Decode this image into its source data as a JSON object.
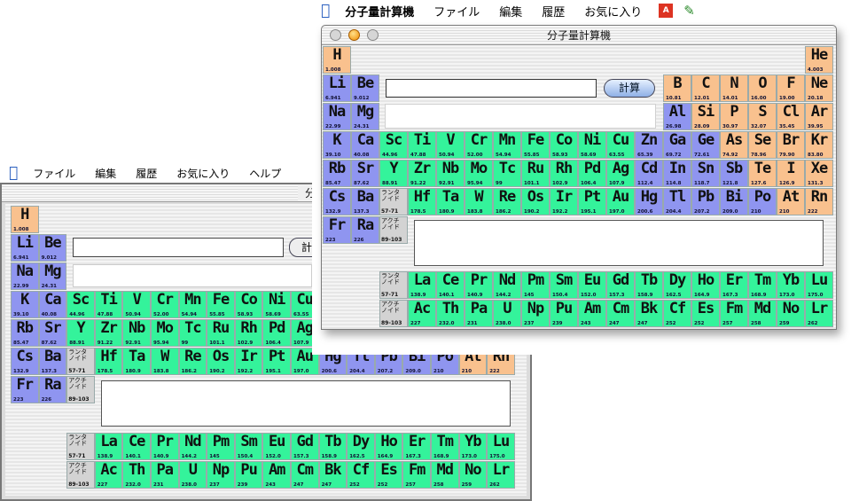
{
  "menubar_back": {
    "items": [
      "ファイル",
      "編集",
      "履歴",
      "お気に入り",
      "ヘルプ"
    ]
  },
  "menubar_front": {
    "items": [
      "分子量計算機",
      "ファイル",
      "編集",
      "履歴",
      "お気に入り"
    ]
  },
  "window_back": {
    "title": "分子量計算機"
  },
  "window_front": {
    "title": "分子量計算機",
    "calc_label": "計算",
    "calc_label_partial": "計"
  },
  "icons": {
    "apple": "apple-icon",
    "app_badge": "acrobat-icon",
    "pen": "pencil-icon"
  },
  "colors": {
    "s_block": "#8f95f0",
    "d_block": "#34f39b",
    "p_block": "#f9c18e",
    "series": "#d3d3d3"
  },
  "table": {
    "elements": [
      {
        "s": "H",
        "w": "1.008",
        "r": 0,
        "c": 0,
        "t": "p"
      },
      {
        "s": "He",
        "w": "4.003",
        "r": 0,
        "c": 17,
        "t": "p"
      },
      {
        "s": "Li",
        "w": "6.941",
        "r": 1,
        "c": 0,
        "t": "s"
      },
      {
        "s": "Be",
        "w": "9.012",
        "r": 1,
        "c": 1,
        "t": "s"
      },
      {
        "s": "B",
        "w": "10.81",
        "r": 1,
        "c": 12,
        "t": "p"
      },
      {
        "s": "C",
        "w": "12.01",
        "r": 1,
        "c": 13,
        "t": "p"
      },
      {
        "s": "N",
        "w": "14.01",
        "r": 1,
        "c": 14,
        "t": "p"
      },
      {
        "s": "O",
        "w": "16.00",
        "r": 1,
        "c": 15,
        "t": "p"
      },
      {
        "s": "F",
        "w": "19.00",
        "r": 1,
        "c": 16,
        "t": "p"
      },
      {
        "s": "Ne",
        "w": "20.18",
        "r": 1,
        "c": 17,
        "t": "p"
      },
      {
        "s": "Na",
        "w": "22.99",
        "r": 2,
        "c": 0,
        "t": "s"
      },
      {
        "s": "Mg",
        "w": "24.31",
        "r": 2,
        "c": 1,
        "t": "s"
      },
      {
        "s": "Al",
        "w": "26.98",
        "r": 2,
        "c": 12,
        "t": "s"
      },
      {
        "s": "Si",
        "w": "28.09",
        "r": 2,
        "c": 13,
        "t": "p"
      },
      {
        "s": "P",
        "w": "30.97",
        "r": 2,
        "c": 14,
        "t": "p"
      },
      {
        "s": "S",
        "w": "32.07",
        "r": 2,
        "c": 15,
        "t": "p"
      },
      {
        "s": "Cl",
        "w": "35.45",
        "r": 2,
        "c": 16,
        "t": "p"
      },
      {
        "s": "Ar",
        "w": "39.95",
        "r": 2,
        "c": 17,
        "t": "p"
      },
      {
        "s": "K",
        "w": "39.10",
        "r": 3,
        "c": 0,
        "t": "s"
      },
      {
        "s": "Ca",
        "w": "40.08",
        "r": 3,
        "c": 1,
        "t": "s"
      },
      {
        "s": "Sc",
        "w": "44.96",
        "r": 3,
        "c": 2,
        "t": "d"
      },
      {
        "s": "Ti",
        "w": "47.88",
        "r": 3,
        "c": 3,
        "t": "d"
      },
      {
        "s": "V",
        "w": "50.94",
        "r": 3,
        "c": 4,
        "t": "d"
      },
      {
        "s": "Cr",
        "w": "52.00",
        "r": 3,
        "c": 5,
        "t": "d"
      },
      {
        "s": "Mn",
        "w": "54.94",
        "r": 3,
        "c": 6,
        "t": "d"
      },
      {
        "s": "Fe",
        "w": "55.85",
        "r": 3,
        "c": 7,
        "t": "d"
      },
      {
        "s": "Co",
        "w": "58.93",
        "r": 3,
        "c": 8,
        "t": "d"
      },
      {
        "s": "Ni",
        "w": "58.69",
        "r": 3,
        "c": 9,
        "t": "d"
      },
      {
        "s": "Cu",
        "w": "63.55",
        "r": 3,
        "c": 10,
        "t": "d"
      },
      {
        "s": "Zn",
        "w": "65.39",
        "r": 3,
        "c": 11,
        "t": "s"
      },
      {
        "s": "Ga",
        "w": "69.72",
        "r": 3,
        "c": 12,
        "t": "s"
      },
      {
        "s": "Ge",
        "w": "72.61",
        "r": 3,
        "c": 13,
        "t": "s"
      },
      {
        "s": "As",
        "w": "74.92",
        "r": 3,
        "c": 14,
        "t": "p"
      },
      {
        "s": "Se",
        "w": "78.96",
        "r": 3,
        "c": 15,
        "t": "p"
      },
      {
        "s": "Br",
        "w": "79.90",
        "r": 3,
        "c": 16,
        "t": "p"
      },
      {
        "s": "Kr",
        "w": "83.80",
        "r": 3,
        "c": 17,
        "t": "p"
      },
      {
        "s": "Rb",
        "w": "85.47",
        "r": 4,
        "c": 0,
        "t": "s"
      },
      {
        "s": "Sr",
        "w": "87.62",
        "r": 4,
        "c": 1,
        "t": "s"
      },
      {
        "s": "Y",
        "w": "88.91",
        "r": 4,
        "c": 2,
        "t": "d"
      },
      {
        "s": "Zr",
        "w": "91.22",
        "r": 4,
        "c": 3,
        "t": "d"
      },
      {
        "s": "Nb",
        "w": "92.91",
        "r": 4,
        "c": 4,
        "t": "d"
      },
      {
        "s": "Mo",
        "w": "95.94",
        "r": 4,
        "c": 5,
        "t": "d"
      },
      {
        "s": "Tc",
        "w": "99",
        "r": 4,
        "c": 6,
        "t": "d"
      },
      {
        "s": "Ru",
        "w": "101.1",
        "r": 4,
        "c": 7,
        "t": "d"
      },
      {
        "s": "Rh",
        "w": "102.9",
        "r": 4,
        "c": 8,
        "t": "d"
      },
      {
        "s": "Pd",
        "w": "106.4",
        "r": 4,
        "c": 9,
        "t": "d"
      },
      {
        "s": "Ag",
        "w": "107.9",
        "r": 4,
        "c": 10,
        "t": "d"
      },
      {
        "s": "Cd",
        "w": "112.4",
        "r": 4,
        "c": 11,
        "t": "s"
      },
      {
        "s": "In",
        "w": "114.8",
        "r": 4,
        "c": 12,
        "t": "s"
      },
      {
        "s": "Sn",
        "w": "118.7",
        "r": 4,
        "c": 13,
        "t": "s"
      },
      {
        "s": "Sb",
        "w": "121.8",
        "r": 4,
        "c": 14,
        "t": "s"
      },
      {
        "s": "Te",
        "w": "127.6",
        "r": 4,
        "c": 15,
        "t": "p"
      },
      {
        "s": "I",
        "w": "126.9",
        "r": 4,
        "c": 16,
        "t": "p"
      },
      {
        "s": "Xe",
        "w": "131.3",
        "r": 4,
        "c": 17,
        "t": "p"
      },
      {
        "s": "Cs",
        "w": "132.9",
        "r": 5,
        "c": 0,
        "t": "s"
      },
      {
        "s": "Ba",
        "w": "137.3",
        "r": 5,
        "c": 1,
        "t": "s"
      },
      {
        "s": "Hf",
        "w": "178.5",
        "r": 5,
        "c": 3,
        "t": "d"
      },
      {
        "s": "Ta",
        "w": "180.9",
        "r": 5,
        "c": 4,
        "t": "d"
      },
      {
        "s": "W",
        "w": "183.8",
        "r": 5,
        "c": 5,
        "t": "d"
      },
      {
        "s": "Re",
        "w": "186.2",
        "r": 5,
        "c": 6,
        "t": "d"
      },
      {
        "s": "Os",
        "w": "190.2",
        "r": 5,
        "c": 7,
        "t": "d"
      },
      {
        "s": "Ir",
        "w": "192.2",
        "r": 5,
        "c": 8,
        "t": "d"
      },
      {
        "s": "Pt",
        "w": "195.1",
        "r": 5,
        "c": 9,
        "t": "d"
      },
      {
        "s": "Au",
        "w": "197.0",
        "r": 5,
        "c": 10,
        "t": "d"
      },
      {
        "s": "Hg",
        "w": "200.6",
        "r": 5,
        "c": 11,
        "t": "s"
      },
      {
        "s": "Tl",
        "w": "204.4",
        "r": 5,
        "c": 12,
        "t": "s"
      },
      {
        "s": "Pb",
        "w": "207.2",
        "r": 5,
        "c": 13,
        "t": "s"
      },
      {
        "s": "Bi",
        "w": "209.0",
        "r": 5,
        "c": 14,
        "t": "s"
      },
      {
        "s": "Po",
        "w": "210",
        "r": 5,
        "c": 15,
        "t": "s"
      },
      {
        "s": "At",
        "w": "210",
        "r": 5,
        "c": 16,
        "t": "p"
      },
      {
        "s": "Rn",
        "w": "222",
        "r": 5,
        "c": 17,
        "t": "p"
      },
      {
        "s": "Fr",
        "w": "223",
        "r": 6,
        "c": 0,
        "t": "s"
      },
      {
        "s": "Ra",
        "w": "226",
        "r": 6,
        "c": 1,
        "t": "s"
      },
      {
        "s": "La",
        "w": "138.9",
        "r": 8,
        "c": 3,
        "t": "f"
      },
      {
        "s": "Ce",
        "w": "140.1",
        "r": 8,
        "c": 4,
        "t": "f"
      },
      {
        "s": "Pr",
        "w": "140.9",
        "r": 8,
        "c": 5,
        "t": "f"
      },
      {
        "s": "Nd",
        "w": "144.2",
        "r": 8,
        "c": 6,
        "t": "f"
      },
      {
        "s": "Pm",
        "w": "145",
        "r": 8,
        "c": 7,
        "t": "f"
      },
      {
        "s": "Sm",
        "w": "150.4",
        "r": 8,
        "c": 8,
        "t": "f"
      },
      {
        "s": "Eu",
        "w": "152.0",
        "r": 8,
        "c": 9,
        "t": "f"
      },
      {
        "s": "Gd",
        "w": "157.3",
        "r": 8,
        "c": 10,
        "t": "f"
      },
      {
        "s": "Tb",
        "w": "158.9",
        "r": 8,
        "c": 11,
        "t": "f"
      },
      {
        "s": "Dy",
        "w": "162.5",
        "r": 8,
        "c": 12,
        "t": "f"
      },
      {
        "s": "Ho",
        "w": "164.9",
        "r": 8,
        "c": 13,
        "t": "f"
      },
      {
        "s": "Er",
        "w": "167.3",
        "r": 8,
        "c": 14,
        "t": "f"
      },
      {
        "s": "Tm",
        "w": "168.9",
        "r": 8,
        "c": 15,
        "t": "f"
      },
      {
        "s": "Yb",
        "w": "173.0",
        "r": 8,
        "c": 16,
        "t": "f"
      },
      {
        "s": "Lu",
        "w": "175.0",
        "r": 8,
        "c": 17,
        "t": "f"
      },
      {
        "s": "Ac",
        "w": "227",
        "r": 9,
        "c": 3,
        "t": "f"
      },
      {
        "s": "Th",
        "w": "232.0",
        "r": 9,
        "c": 4,
        "t": "f"
      },
      {
        "s": "Pa",
        "w": "231",
        "r": 9,
        "c": 5,
        "t": "f"
      },
      {
        "s": "U",
        "w": "238.0",
        "r": 9,
        "c": 6,
        "t": "f"
      },
      {
        "s": "Np",
        "w": "237",
        "r": 9,
        "c": 7,
        "t": "f"
      },
      {
        "s": "Pu",
        "w": "239",
        "r": 9,
        "c": 8,
        "t": "f"
      },
      {
        "s": "Am",
        "w": "243",
        "r": 9,
        "c": 9,
        "t": "f"
      },
      {
        "s": "Cm",
        "w": "247",
        "r": 9,
        "c": 10,
        "t": "f"
      },
      {
        "s": "Bk",
        "w": "247",
        "r": 9,
        "c": 11,
        "t": "f"
      },
      {
        "s": "Cf",
        "w": "252",
        "r": 9,
        "c": 12,
        "t": "f"
      },
      {
        "s": "Es",
        "w": "252",
        "r": 9,
        "c": 13,
        "t": "f"
      },
      {
        "s": "Fm",
        "w": "257",
        "r": 9,
        "c": 14,
        "t": "f"
      },
      {
        "s": "Md",
        "w": "258",
        "r": 9,
        "c": 15,
        "t": "f"
      },
      {
        "s": "No",
        "w": "259",
        "r": 9,
        "c": 16,
        "t": "f"
      },
      {
        "s": "Lr",
        "w": "262",
        "r": 9,
        "c": 17,
        "t": "f"
      }
    ],
    "series_refs": [
      {
        "lbl": "ランタ\nノイド",
        "rng": "57-71",
        "r": 5,
        "c": 2
      },
      {
        "lbl": "アクチ\nノイド",
        "rng": "89-103",
        "r": 6,
        "c": 2
      },
      {
        "lbl": "ランタ\nノイド",
        "rng": "57-71",
        "r": 8,
        "c": 2
      },
      {
        "lbl": "アクチ\nノイド",
        "rng": "89-103",
        "r": 9,
        "c": 2
      }
    ]
  }
}
